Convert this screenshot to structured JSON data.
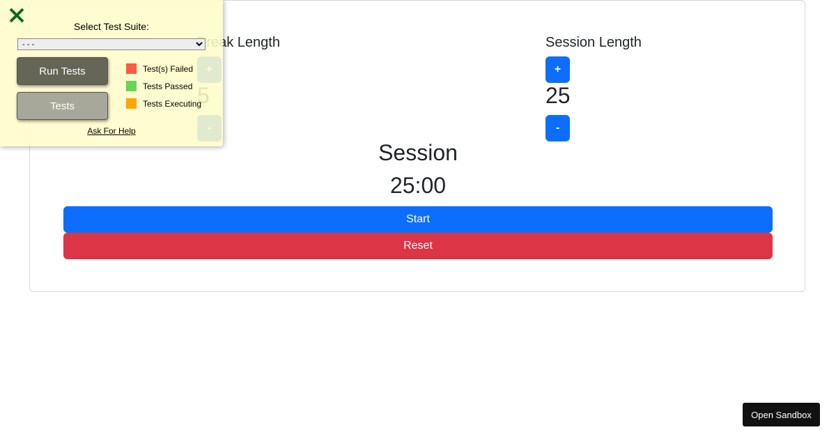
{
  "break": {
    "label": "Break Length",
    "increment_label": "+",
    "value": "5",
    "decrement_label": "-"
  },
  "session": {
    "label": "Session Length",
    "increment_label": "+",
    "value": "25",
    "decrement_label": "-"
  },
  "timer": {
    "label": "Session",
    "time_left": "25:00",
    "start_label": "Start",
    "reset_label": "Reset"
  },
  "test_panel": {
    "select_label": "Select Test Suite:",
    "selected_option": "- - -",
    "run_tests_label": "Run Tests",
    "tests_label": "Tests",
    "legend": [
      {
        "label": "Test(s) Failed",
        "color": "#ff5a45"
      },
      {
        "label": "Tests Passed",
        "color": "#64d655"
      },
      {
        "label": "Tests Executing",
        "color": "#ffa500"
      }
    ],
    "help_label": "Ask For Help",
    "close_icon_color": "#0a6b12"
  },
  "sandbox": {
    "label": "Open Sandbox"
  },
  "colors": {
    "primary": "#0d6efd",
    "danger": "#dc3545"
  }
}
